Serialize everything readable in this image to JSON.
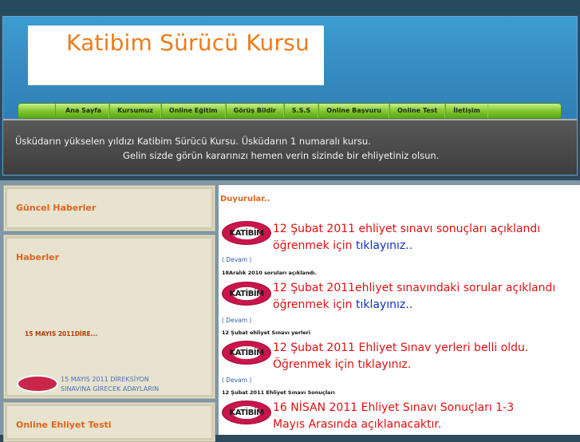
{
  "header": {
    "logo_text": "Katibim Sürücü Kursu",
    "nav": [
      "Ana Sayfa",
      "Kursumuz",
      "Online Eğitim",
      "Görüş Bildir",
      "S.S.S",
      "Online Başvuru",
      "Online Test",
      "İletişim"
    ],
    "banner_line1": "Üsküdarın yükselen yıldızı Katibim Sürücü Kursu. Üsküdarın 1 numaralı kursu.",
    "banner_line2": "Gelin sizde görün kararınızı hemen verin sizinde bir ehliyetiniz olsun."
  },
  "sidebar": {
    "panel1_title": "Güncel Haberler",
    "panel2_title": "Haberler",
    "news_link": "15 MAYIS 2011DİRE...",
    "news_scroll_line1": "15 MAYIS 2011 DİREKSİYON",
    "news_scroll_line2": "SINAVINA GİRECEK ADAYLARIN",
    "panel3_title": "Online Ehliyet Testi"
  },
  "main": {
    "title": "Duyurular..",
    "badge_text": "KATİBİM",
    "items": [
      {
        "line1": "12 Şubat 2011 ehliyet sınavı sonuçları açıklandı",
        "line2_prefix": "öğrenmek için ",
        "line2_link": "tıklayınız..",
        "devam": "( Devam )",
        "next_heading": "18Aralık 2010 soruları açıklandı."
      },
      {
        "line1": "12 Şubat 2011ehliyet sınavındaki sorular açıklandı",
        "line2_prefix": "öğrenmek için ",
        "line2_link": "tıklayınız..",
        "devam": "( Devam )",
        "next_heading": "12 Şubat ehliyet Sınavı yerleri"
      },
      {
        "line1": "12 Şubat 2011 Ehliyet Sınav yerleri belli oldu.",
        "line2_prefix": "Öğrenmek için tıklayınız.",
        "line2_link": "",
        "devam": "( Devam )",
        "next_heading": "12 Şubat 2011 Ehliyet Sınavı Sonuçları"
      },
      {
        "line1": "16  NİSAN 2011 Ehliyet Sınavı Sonuçları  1-3",
        "line2_prefix": "Mayıs Arasında açıklanacaktır.",
        "line2_link": ""
      }
    ]
  },
  "colors": {
    "accent_orange": "#e0641c",
    "headline_red": "#e01010",
    "link_blue": "#1030c8",
    "nav_green": "#7cc42b"
  }
}
